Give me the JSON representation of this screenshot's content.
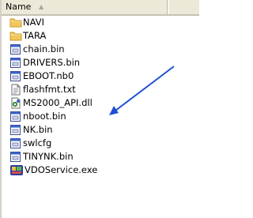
{
  "header": {
    "name_col": "Name",
    "sort_icon": "up-triangle-icon"
  },
  "files": [
    {
      "name": "NAVI",
      "icon": "folder-icon"
    },
    {
      "name": "TARA",
      "icon": "folder-icon"
    },
    {
      "name": "chain.bin",
      "icon": "bin-file-icon"
    },
    {
      "name": "DRIVERS.bin",
      "icon": "bin-file-icon"
    },
    {
      "name": "EBOOT.nb0",
      "icon": "bin-file-icon"
    },
    {
      "name": "flashfmt.txt",
      "icon": "text-file-icon"
    },
    {
      "name": "MS2000_API.dll",
      "icon": "dll-file-icon"
    },
    {
      "name": "nboot.bin",
      "icon": "bin-file-icon"
    },
    {
      "name": "NK.bin",
      "icon": "bin-file-icon"
    },
    {
      "name": "swlcfg",
      "icon": "bin-file-icon"
    },
    {
      "name": "TINYNK.bin",
      "icon": "bin-file-icon"
    },
    {
      "name": "VDOService.exe",
      "icon": "exe-app-icon"
    }
  ],
  "colors": {
    "arrow": "#1f4fd6",
    "header_bg": "#ece9d8",
    "folder": "#f3c65a"
  }
}
